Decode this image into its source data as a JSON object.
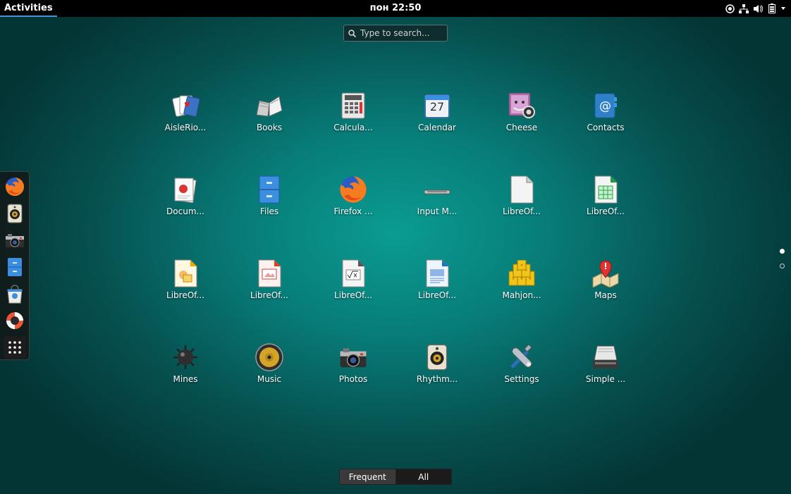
{
  "topbar": {
    "activities_label": "Activities",
    "clock": "пон 22:50",
    "tray_icons": [
      "accessibility-icon",
      "network-icon",
      "volume-icon",
      "battery-icon",
      "dropdown-arrow-icon"
    ]
  },
  "search": {
    "placeholder": "Type to search..."
  },
  "dash": {
    "items": [
      "firefox-icon",
      "rhythmbox-icon",
      "photos-icon",
      "files-icon",
      "software-icon",
      "help-icon",
      "show-apps-icon"
    ]
  },
  "apps": [
    {
      "label": "AisleRio...",
      "icon": "aisleriot-icon"
    },
    {
      "label": "Books",
      "icon": "books-icon"
    },
    {
      "label": "Calcula...",
      "icon": "calculator-icon"
    },
    {
      "label": "Calendar",
      "icon": "calendar-icon",
      "date": "27"
    },
    {
      "label": "Cheese",
      "icon": "cheese-icon"
    },
    {
      "label": "Contacts",
      "icon": "contacts-icon"
    },
    {
      "label": "Docum...",
      "icon": "documents-icon"
    },
    {
      "label": "Files",
      "icon": "files-icon"
    },
    {
      "label": "Firefox ...",
      "icon": "firefox-icon"
    },
    {
      "label": "Input M...",
      "icon": "input-method-icon"
    },
    {
      "label": "LibreOf...",
      "icon": "libreoffice-icon"
    },
    {
      "label": "LibreOf...",
      "icon": "libreoffice-calc-icon"
    },
    {
      "label": "LibreOf...",
      "icon": "libreoffice-draw-icon"
    },
    {
      "label": "LibreOf...",
      "icon": "libreoffice-impress-icon"
    },
    {
      "label": "LibreOf...",
      "icon": "libreoffice-math-icon"
    },
    {
      "label": "LibreOf...",
      "icon": "libreoffice-writer-icon"
    },
    {
      "label": "Mahjon...",
      "icon": "mahjongg-icon"
    },
    {
      "label": "Maps",
      "icon": "maps-icon"
    },
    {
      "label": "Mines",
      "icon": "mines-icon"
    },
    {
      "label": "Music",
      "icon": "music-icon"
    },
    {
      "label": "Photos",
      "icon": "photos-icon"
    },
    {
      "label": "Rhythm...",
      "icon": "rhythmbox-icon"
    },
    {
      "label": "Settings",
      "icon": "settings-icon"
    },
    {
      "label": "Simple ...",
      "icon": "simple-scan-icon"
    }
  ],
  "view_switch": {
    "frequent_label": "Frequent",
    "all_label": "All"
  },
  "colors": {
    "background_center": "#0a9c92",
    "background_edge": "#043535",
    "topbar": "#000000",
    "accent": "#4a90d9"
  }
}
